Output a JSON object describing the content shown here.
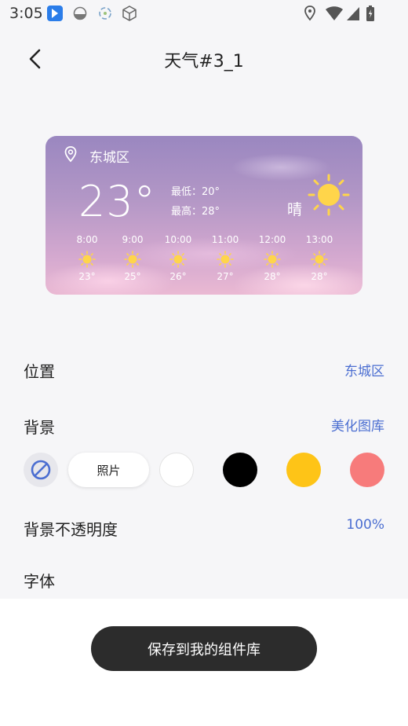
{
  "status_bar": {
    "time": "3:05",
    "left_icons": [
      "bird-app-icon",
      "drop-icon",
      "recycle-icon",
      "cube-icon"
    ],
    "right_icons": [
      "location-icon",
      "wifi-icon",
      "signal-icon",
      "battery-icon"
    ]
  },
  "header": {
    "title": "天气#3_1",
    "back_icon": "chevron-left-icon"
  },
  "widget": {
    "location": "东城区",
    "temperature": "23°",
    "low": "最低：20°",
    "high": "最高：28°",
    "condition": "晴",
    "hourly": [
      {
        "time": "8:00",
        "temp": "23°"
      },
      {
        "time": "9:00",
        "temp": "25°"
      },
      {
        "time": "10:00",
        "temp": "26°"
      },
      {
        "time": "11:00",
        "temp": "27°"
      },
      {
        "time": "12:00",
        "temp": "28°"
      },
      {
        "time": "13:00",
        "temp": "28°"
      }
    ]
  },
  "settings": {
    "location": {
      "label": "位置",
      "value": "东城区"
    },
    "background": {
      "label": "背景",
      "value": "美化图库"
    },
    "photo_label": "照片",
    "swatches": [
      "#ffffff",
      "#000000",
      "#fec417",
      "#f77b7b"
    ],
    "opacity": {
      "label": "背景不透明度",
      "value": "100%"
    },
    "font": {
      "label": "字体"
    }
  },
  "save_button": "保存到我的组件库",
  "colors": {
    "accent": "#4b6ed1",
    "sun": "#ffd54a",
    "button_bg": "#2c2c2c"
  }
}
